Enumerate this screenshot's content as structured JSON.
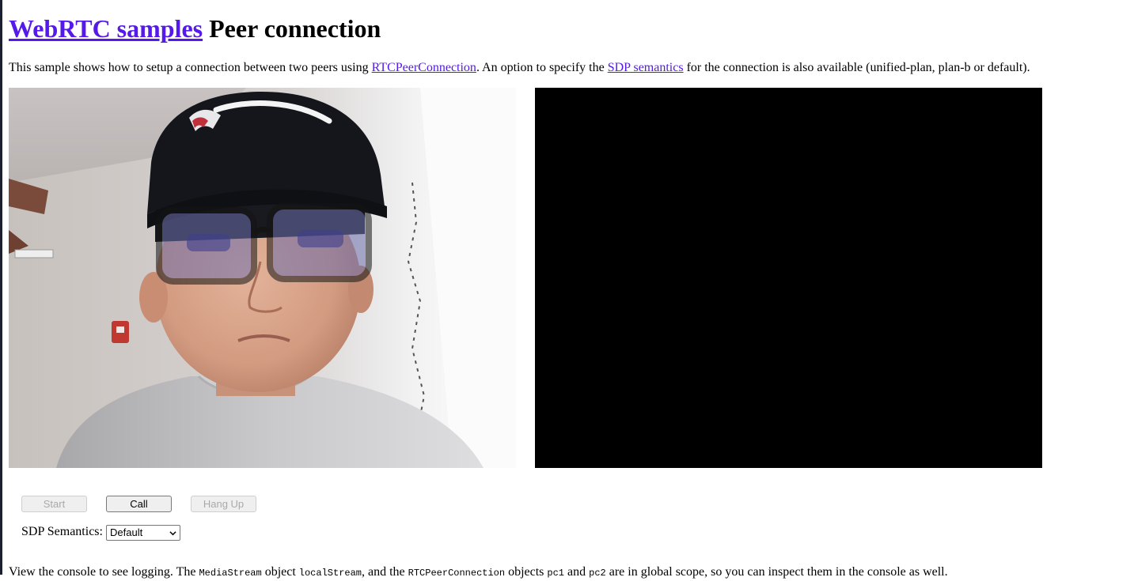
{
  "header": {
    "link_text": "WebRTC samples",
    "title_text": "Peer connection"
  },
  "intro": {
    "part1": "This sample shows how to setup a connection between two peers using ",
    "link1": "RTCPeerConnection",
    "part2": ". An option to specify the ",
    "link2": "SDP semantics",
    "part3": " for the connection is also available (unified-plan, plan-b or default)."
  },
  "videos": {
    "local": {
      "state": "playing-camera"
    },
    "remote": {
      "state": "black"
    }
  },
  "buttons": {
    "start": {
      "label": "Start",
      "enabled": false
    },
    "call": {
      "label": "Call",
      "enabled": true
    },
    "hangup": {
      "label": "Hang Up",
      "enabled": false
    }
  },
  "sdp": {
    "label": "SDP Semantics:",
    "selected": "Default"
  },
  "footer": {
    "t1": "View the console to see logging. The ",
    "c1": "MediaStream",
    "t2": " object ",
    "c2": "localStream",
    "t3": ", and the ",
    "c3": "RTCPeerConnection",
    "t4": " objects ",
    "c4": "pc1",
    "t5": " and ",
    "c5": "pc2",
    "t6": " are in global scope, so you can inspect them in the console as well."
  },
  "colors": {
    "link": "#551aeb",
    "page_background": "#ffffff",
    "remote_video": "#000000"
  }
}
